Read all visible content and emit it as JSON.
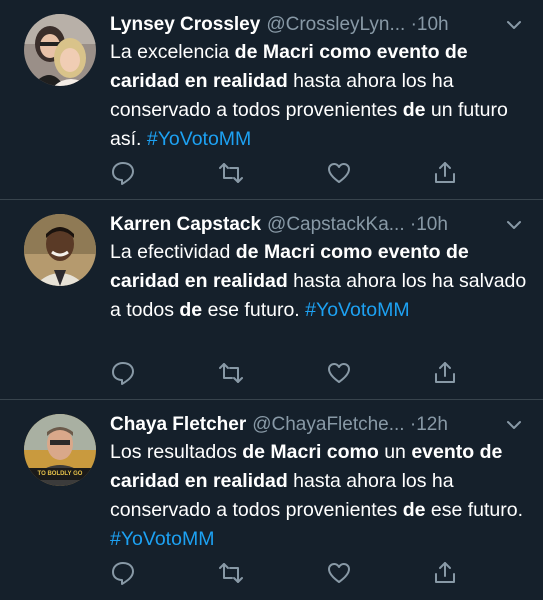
{
  "tweets": [
    {
      "name": "Lynsey Crossley",
      "handle": "@CrossleyLyn...",
      "sep": "·",
      "time": "10h",
      "avatar": "avatar-two-women",
      "text": [
        {
          "t": "La excelencia ",
          "b": false
        },
        {
          "t": "de Macri como evento de caridad en realidad",
          "b": true
        },
        {
          "t": " hasta ahora los ha conservado a todos provenientes ",
          "b": false
        },
        {
          "t": "de",
          "b": true
        },
        {
          "t": " un futuro así. ",
          "b": false
        }
      ],
      "hashtag": "#YoVotoMM"
    },
    {
      "name": "Karren Capstack",
      "handle": "@CapstackKa...",
      "sep": "·",
      "time": "10h",
      "avatar": "avatar-smiling-man",
      "text": [
        {
          "t": "La efectividad ",
          "b": false
        },
        {
          "t": "de Macri como evento de caridad en realidad",
          "b": true
        },
        {
          "t": " hasta ahora los ha salvado a todos ",
          "b": false
        },
        {
          "t": "de",
          "b": true
        },
        {
          "t": " ese futuro. ",
          "b": false
        }
      ],
      "hashtag": "#YoVotoMM"
    },
    {
      "name": "Chaya Fletcher",
      "handle": "@ChayaFletche...",
      "sep": "·",
      "time": "12h",
      "avatar": "avatar-man-glasses",
      "badge": "TO BOLDLY GO",
      "text": [
        {
          "t": "Los resultados ",
          "b": false
        },
        {
          "t": "de Macri como",
          "b": true
        },
        {
          "t": " un ",
          "b": false
        },
        {
          "t": "evento de caridad en realidad",
          "b": true
        },
        {
          "t": " hasta ahora los ha conservado a todos provenientes ",
          "b": false
        },
        {
          "t": "de",
          "b": true
        },
        {
          "t": " ese futuro. ",
          "b": false
        }
      ],
      "hashtag": "#YoVotoMM"
    }
  ],
  "icons": {
    "reply": "reply-icon",
    "retweet": "retweet-icon",
    "like": "heart-icon",
    "share": "share-icon",
    "menu": "chevron-down-icon"
  },
  "colors": {
    "background": "#15202b",
    "secondary_text": "#8899a6",
    "link": "#1da1f2",
    "divider": "#38444d"
  }
}
